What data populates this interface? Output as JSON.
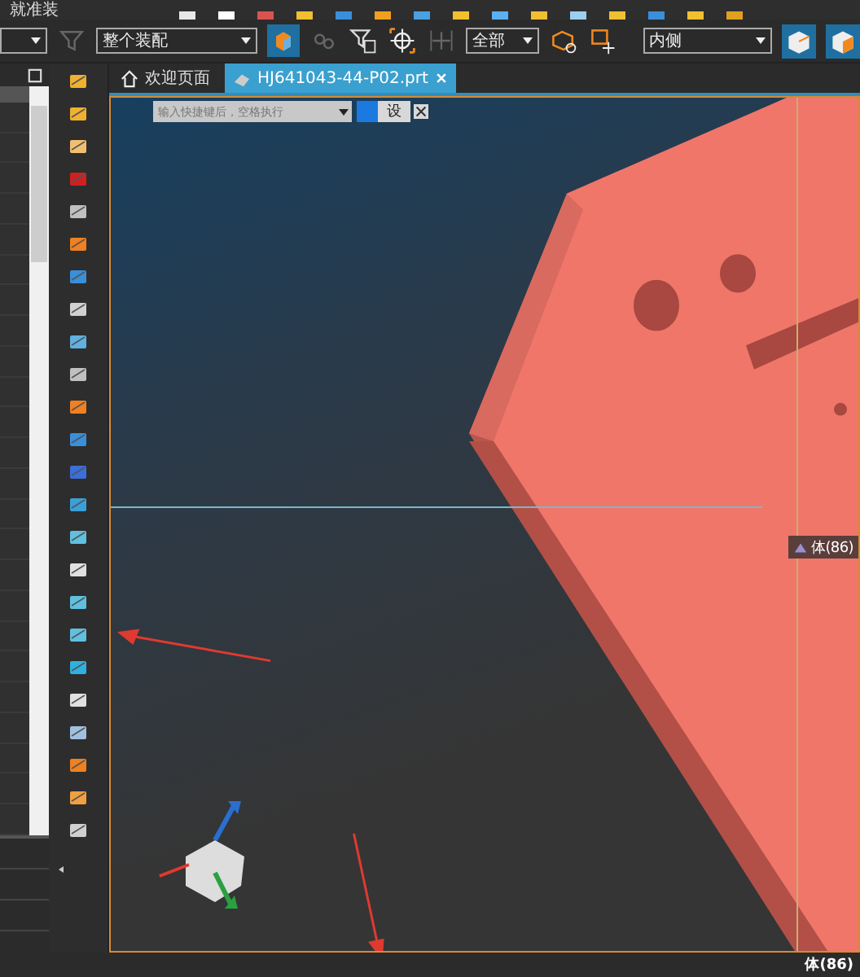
{
  "menu": {
    "title": "就准装"
  },
  "toolbar": {
    "assembly_scope": "整个装配",
    "filter": "全部",
    "side": "内侧"
  },
  "tabs": [
    {
      "label": "欢迎页面",
      "selected": false,
      "kind": "home"
    },
    {
      "label": "HJ641043-44-P02.prt",
      "selected": true,
      "kind": "part"
    }
  ],
  "command_search": {
    "placeholder": "输入快捷键后，空格执行",
    "button": "设"
  },
  "viewport": {
    "tooltip": "体(86)"
  },
  "status_bar": {
    "selection": "体(86)"
  }
}
